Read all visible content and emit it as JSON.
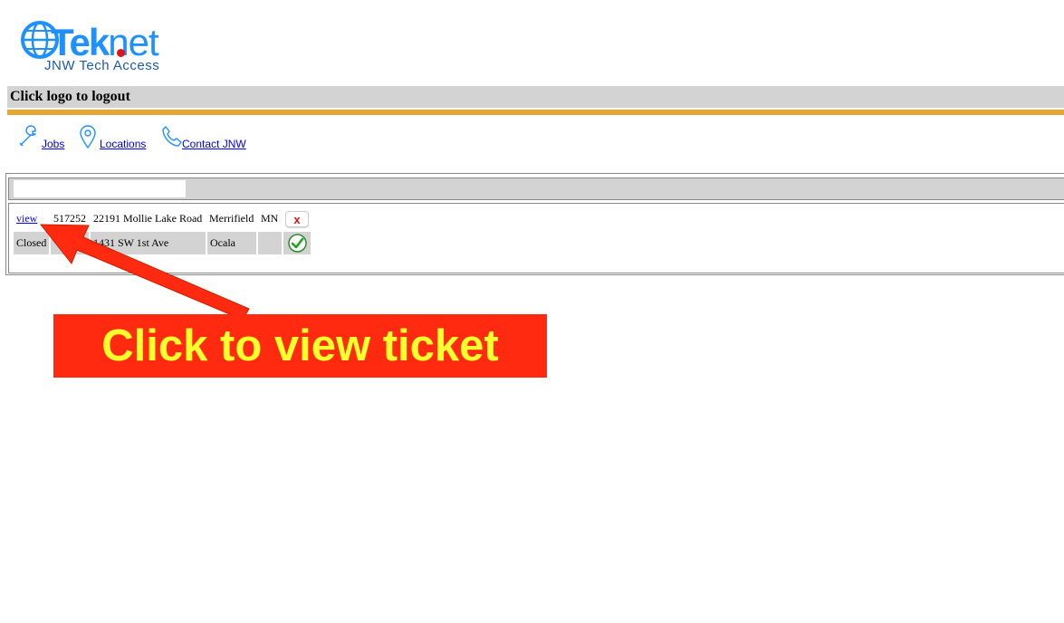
{
  "logo": {
    "wordmark_main": "Tek",
    "wordmark_suffix": "net",
    "tagline": "JNW Tech Access",
    "colors": {
      "primary": "#1e90ff",
      "dot": "#e0141b"
    }
  },
  "header": {
    "logout_text": "Click logo to logout",
    "bar_color": "#d3d3d3",
    "rule_color": "#e8a531"
  },
  "nav": {
    "items": [
      {
        "label": "Jobs",
        "icon": "wrench-icon"
      },
      {
        "label": "Locations",
        "icon": "map-pin-icon"
      },
      {
        "label": "Contact JNW",
        "icon": "phone-icon"
      }
    ]
  },
  "search": {
    "value": "",
    "placeholder": ""
  },
  "jobs": {
    "rows": [
      {
        "action_label": "view",
        "job_number": "517252",
        "address": "22191 Mollie Lake Road",
        "city": "Merrifield",
        "state": "MN",
        "status_icon": "close-x-icon",
        "status_symbol": "x"
      },
      {
        "status": "Closed",
        "job_number": "",
        "address": "1431 SW 1st Ave",
        "city": "Ocala",
        "state": "",
        "status_icon": "green-check-icon"
      }
    ]
  },
  "annotation": {
    "callout_text": "Click to view ticket",
    "background": "#ff2a0f",
    "text_color": "#ffff2e"
  }
}
